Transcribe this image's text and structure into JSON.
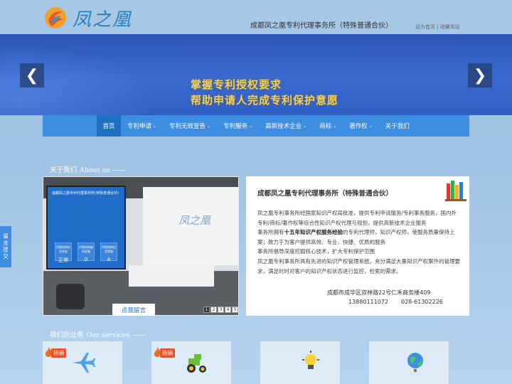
{
  "header": {
    "logo_text": "凤之凰",
    "firm_name": "成都凤之凰专利代理事务所（特殊普通合伙）",
    "top_links": [
      "设为首页",
      "收藏本站"
    ],
    "top_links_sep": " | "
  },
  "banner": {
    "line1": "掌握专利授权要求",
    "line2": "帮助申请人完成专利保护意愿",
    "prev_icon": "chevron-left-icon",
    "next_icon": "chevron-right-icon"
  },
  "nav": {
    "items": [
      {
        "label": "首页",
        "caret": false,
        "active": true
      },
      {
        "label": "专利申请",
        "caret": true
      },
      {
        "label": "专利无效宣告",
        "caret": true
      },
      {
        "label": "专利服务",
        "caret": true
      },
      {
        "label": "高新技术企业",
        "caret": true
      },
      {
        "label": "商标",
        "caret": true
      },
      {
        "label": "著作权",
        "caret": true
      },
      {
        "label": "关于我们",
        "caret": false
      }
    ]
  },
  "about": {
    "title_cn": "关于我们",
    "title_en": "About us ——",
    "photo": {
      "screen_title": "成都凤之凰专利代理事务所(特殊普通合伙)",
      "tiles": [
        {
          "label": "代理机构执业状态",
          "value": "正常"
        },
        {
          "label": "代理机构被投诉量",
          "value": "0"
        },
        {
          "label": "代理机构信用等级",
          "value": "A"
        }
      ],
      "wall_logo": "凤之凰"
    },
    "message_button": "点我留言",
    "pager": [
      "1",
      "2",
      "3",
      "4",
      "5"
    ],
    "pager_active": "1"
  },
  "intro": {
    "title": "成都凤之凰专利代理事务所（特殊普通合伙）",
    "p1": "凤之凰专利事务所经国家知识产权局批准，提供专利申请服务/专利事务服务，国内外专利/商标/著作权等综合性知识产权代理与规划，提供高新技术企业服务",
    "p2_pre": "事务所拥有",
    "p2_bold": "十五年知识产权服务经验",
    "p2_post": "的专利代理师，知识产权师，使服务质量保持上案；致力于为客户提供高效、专业、快捷、优质的服务",
    "p3": "事务所倡导深度挖掘核心技术，扩大专利保护范围",
    "p4": "凤之凰专利事务所具有先进的知识产权管理系统，充分满足大量知识产权案件的管理要求，满足时时对客户的知识产权状态进行监控，检索的需求。",
    "address": "成都市成华区双林路22号仁禾商务楼409",
    "phone1": "13880111072",
    "phone2": "028-61302226"
  },
  "side_tab": "留言提交",
  "services": {
    "title_cn": "我们的业务",
    "title_en": "Our services ——",
    "hot_label": "热销",
    "cards": [
      {
        "icon": "airplane-icon",
        "hot": true
      },
      {
        "icon": "tractor-icon",
        "hot": true
      },
      {
        "icon": "lightbulb-icon",
        "hot": false
      },
      {
        "icon": "globe-icon",
        "hot": false
      }
    ]
  },
  "colors": {
    "nav_bg": "#3d8de0",
    "nav_active": "#1e6fc4",
    "banner_bg": "#2f5fc4",
    "banner_text": "#e9d36a",
    "hot_badge": "#e8542a"
  }
}
